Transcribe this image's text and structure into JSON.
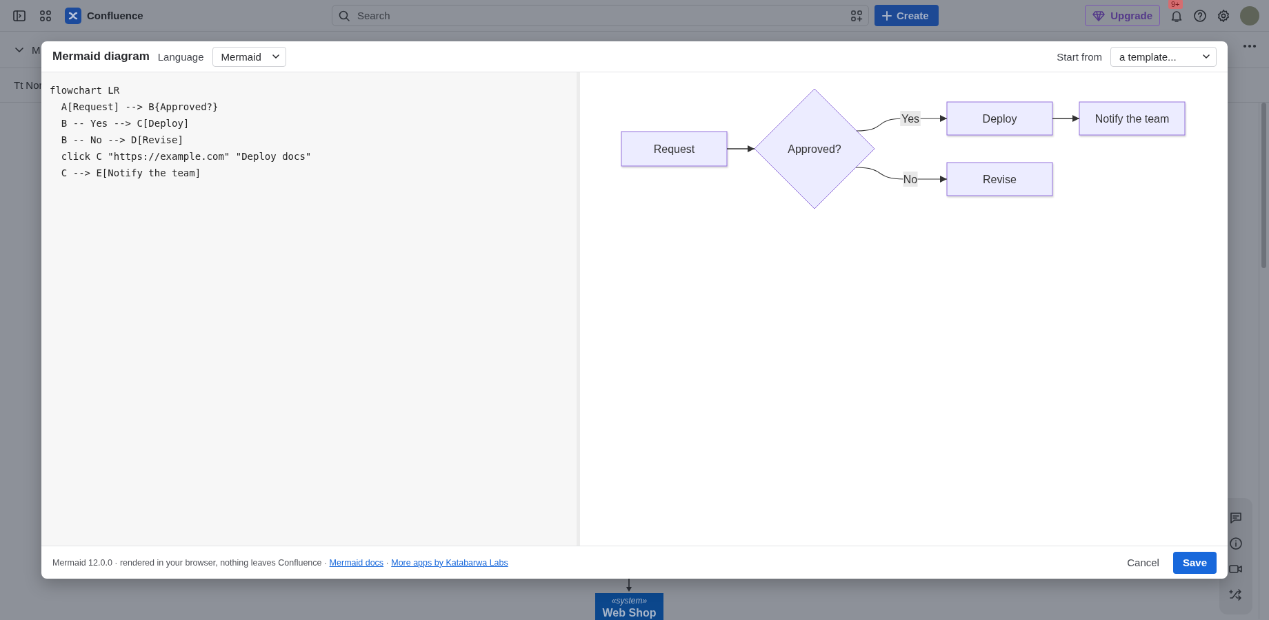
{
  "top_bar": {
    "product": "Confluence",
    "search": {
      "placeholder": "Search"
    },
    "create_button": "Create",
    "upgrade_button": "Upgrade",
    "notifications_badge": "9+"
  },
  "page_behind": {
    "toolbar_text": "M",
    "format_label": "Tt",
    "format_value": "Nor",
    "diagram_box": {
      "stereotype": "«system»",
      "title": "Web Shop"
    }
  },
  "modal": {
    "title": "Mermaid diagram",
    "language_label": "Language",
    "language_value": "Mermaid",
    "template_label": "Start from",
    "template_value": "a template...",
    "code_lines": [
      "flowchart LR",
      "  A[Request] --> B{Approved?}",
      "  B -- Yes --> C[Deploy]",
      "  B -- No --> D[Revise]",
      "  click C \"https://example.com\" \"Deploy docs\"",
      "  C --> E[Notify the team]"
    ],
    "diagram": {
      "nodes": [
        {
          "label": "Request",
          "kind": "process"
        },
        {
          "label": "Approved?",
          "kind": "decision"
        },
        {
          "label": "Deploy",
          "kind": "process"
        },
        {
          "label": "Revise",
          "kind": "process"
        },
        {
          "label": "Notify the team",
          "kind": "process"
        }
      ],
      "edges": [
        {
          "kind": "straight"
        },
        {
          "kind": "curve",
          "label": "Yes"
        },
        {
          "kind": "curve",
          "label": "No"
        },
        {
          "kind": "straight"
        }
      ]
    },
    "footer": {
      "note": "Mermaid 12.0.0 · rendered in your browser, nothing leaves Confluence ·",
      "links": [
        "Mermaid docs",
        "More apps by Katabarwa Labs"
      ],
      "separator": "·"
    },
    "buttons": [
      {
        "label": "Cancel",
        "kind": "subtle"
      },
      {
        "label": "Save",
        "kind": "primary"
      }
    ]
  }
}
